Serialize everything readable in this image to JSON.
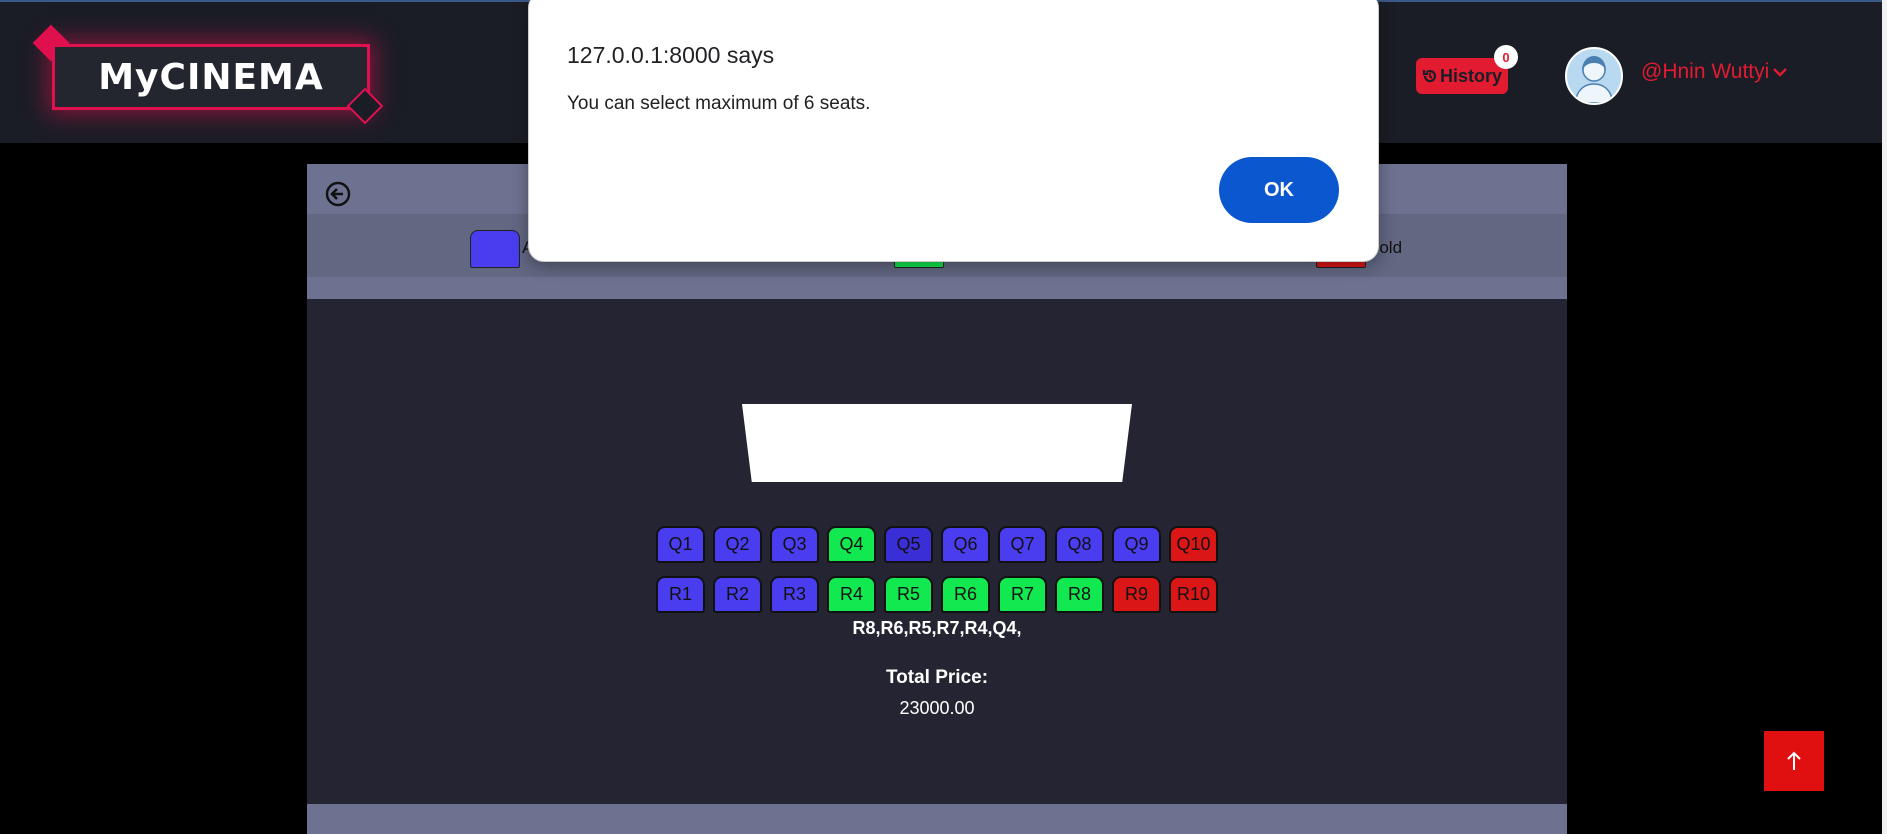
{
  "navbar": {
    "logo_text": "MyCINEMA",
    "history_label": "History",
    "history_count": "0",
    "username": "@Hnin Wuttyi"
  },
  "legend": {
    "available_label": "A",
    "sold_label": "Sold"
  },
  "seats": {
    "row_q": [
      "Q1",
      "Q2",
      "Q3",
      "Q4",
      "Q5",
      "Q6",
      "Q7",
      "Q8",
      "Q9",
      "Q10"
    ],
    "row_r": [
      "R1",
      "R2",
      "R3",
      "R4",
      "R5",
      "R6",
      "R7",
      "R8",
      "R9",
      "R10"
    ]
  },
  "booking": {
    "selected_seats": "R8,R6,R5,R7,R4,Q4,",
    "total_label": "Total Price:",
    "total_value": "23000.00"
  },
  "dialog": {
    "title": "127.0.0.1:8000 says",
    "message": "You can select maximum of 6 seats.",
    "ok_label": "OK"
  },
  "colors": {
    "available": "#4a3df0",
    "selected": "#12e850",
    "sold": "#db1616",
    "accent": "#e0114f"
  }
}
